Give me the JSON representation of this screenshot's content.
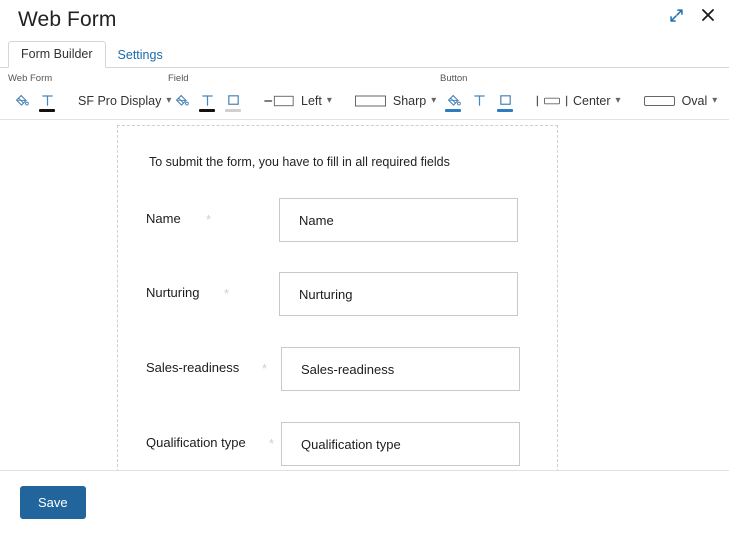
{
  "window": {
    "title": "Web Form",
    "controls": [
      {
        "name": "expand-icon",
        "label": "Expand"
      },
      {
        "name": "close-icon",
        "label": "Close"
      }
    ]
  },
  "tabs": [
    {
      "label": "Form Builder",
      "active": true
    },
    {
      "label": "Settings",
      "active": false
    }
  ],
  "toolbar": {
    "groups": [
      {
        "label": "Web Form",
        "icons": [
          {
            "name": "fill-color-icon",
            "underline": "none"
          },
          {
            "name": "text-color-icon",
            "underline": "black"
          }
        ],
        "dropdowns": [
          {
            "name": "font-family-dropdown",
            "value": "SF Pro Display",
            "swatch": "none"
          }
        ]
      },
      {
        "label": "Field",
        "icons": [
          {
            "name": "fill-color-icon",
            "underline": "none"
          },
          {
            "name": "text-color-icon",
            "underline": "black"
          },
          {
            "name": "border-color-icon",
            "underline": "grey"
          }
        ],
        "dropdowns": [
          {
            "name": "label-alignment-dropdown",
            "value": "Left",
            "swatch": "align-left"
          },
          {
            "name": "field-shape-dropdown",
            "value": "Sharp",
            "swatch": "sharp-rect"
          }
        ]
      },
      {
        "label": "Button",
        "icons": [
          {
            "name": "fill-color-icon",
            "underline": "blue"
          },
          {
            "name": "text-color-icon",
            "underline": "none"
          },
          {
            "name": "border-color-icon",
            "underline": "blue"
          }
        ],
        "dropdowns": [
          {
            "name": "button-alignment-dropdown",
            "value": "Center",
            "swatch": "align-center"
          },
          {
            "name": "button-shape-dropdown",
            "value": "Oval",
            "swatch": "oval-rect"
          }
        ]
      }
    ]
  },
  "form": {
    "notice": "To submit the form, you have to fill in all required fields",
    "required_marker": "*",
    "fields": [
      {
        "label": "Name",
        "placeholder": "Name",
        "required": true
      },
      {
        "label": "Nurturing",
        "placeholder": "Nurturing",
        "required": true
      },
      {
        "label": "Sales-readiness",
        "placeholder": "Sales-readiness",
        "required": true
      },
      {
        "label": "Qualification type",
        "placeholder": "Qualification type",
        "required": true
      }
    ]
  },
  "footer": {
    "save_label": "Save"
  },
  "colors": {
    "accent_blue": "#22659c",
    "link_blue": "#1a6baa",
    "icon_blue": "#4a86b8",
    "underline_blue": "#2d7cc0"
  }
}
